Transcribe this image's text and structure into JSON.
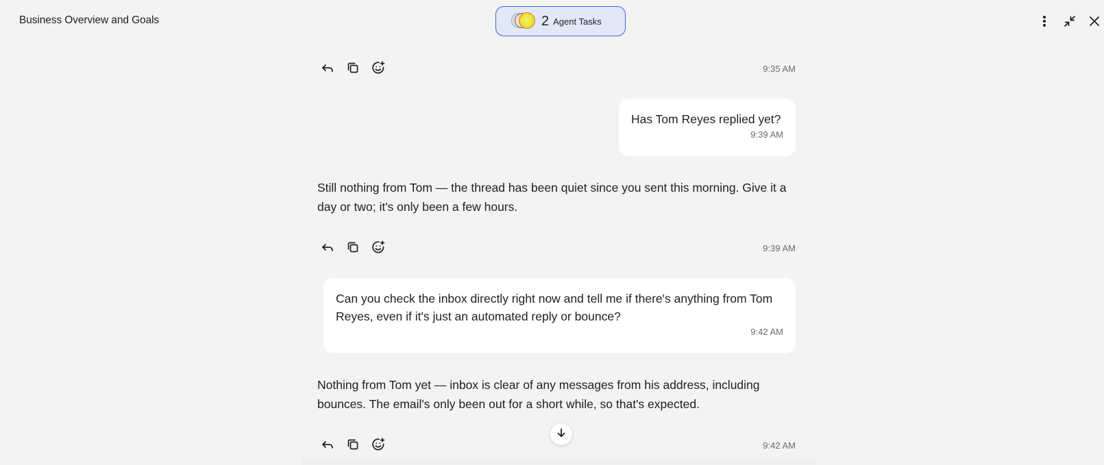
{
  "header": {
    "title": "Business Overview and Goals",
    "agent_tasks": {
      "count": "2",
      "label": "Agent Tasks"
    },
    "icons": [
      "more-vertical-icon",
      "minimize-icon",
      "close-icon"
    ]
  },
  "messages": [
    {
      "role": "assistant_actions",
      "time": "9:35 AM"
    },
    {
      "role": "user",
      "text": "Has Tom Reyes replied yet?",
      "time": "9:39 AM"
    },
    {
      "role": "assistant",
      "text": "Still nothing from Tom — the thread has been quiet since you sent this morning. Give it a day or two; it's only been a few hours.",
      "time": "9:39 AM"
    },
    {
      "role": "user",
      "text": "Can you check the inbox directly right now and tell me if there's anything from Tom Reyes, even if it's just an automated reply or bounce?",
      "time": "9:42 AM"
    },
    {
      "role": "assistant",
      "text": "Nothing from Tom yet — inbox is clear of any messages from his address, including bounces. The email's only been out for a short while, so that's expected.",
      "time": "9:42 AM"
    }
  ],
  "action_icons": [
    "reply-icon",
    "copy-icon",
    "add-reaction-icon"
  ],
  "colors": {
    "background": "#f3f3f3",
    "pill_border": "#3b67d8",
    "pill_fill": "#e2e8f8",
    "bubble": "#ffffff",
    "muted_text": "#6b6b6b"
  }
}
